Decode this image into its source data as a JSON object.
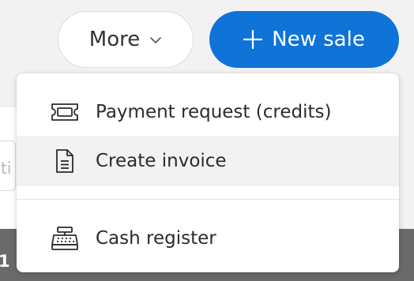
{
  "header": {
    "more_button": {
      "label": "More"
    },
    "new_sale_button": {
      "label": "New sale"
    }
  },
  "background": {
    "input_fragment": "ti",
    "row_fragment": "1"
  },
  "menu": {
    "items": [
      {
        "label": "Payment request (credits)",
        "icon": "ticket-icon"
      },
      {
        "label": "Create invoice",
        "icon": "document-icon"
      },
      {
        "label": "Cash register",
        "icon": "cash-register-icon"
      }
    ],
    "highlighted_index": 1
  },
  "colors": {
    "accent": "#0f73d8",
    "text": "#2b2b2b",
    "hover": "#f2f2f2"
  }
}
